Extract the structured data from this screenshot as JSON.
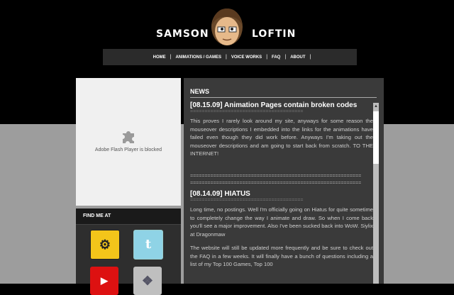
{
  "header": {
    "logo_left": "SAMSON",
    "logo_right": "LOFTIN"
  },
  "nav": {
    "items": [
      "HOME",
      "ANIMATIONS / GAMES",
      "VOICE WORKS",
      "FAQ",
      "ABOUT"
    ],
    "separator": "|"
  },
  "flash": {
    "message": "Adobe Flash Player is blocked"
  },
  "find_me": {
    "heading": "FIND ME AT",
    "links": [
      "game-icon",
      "twitter-icon",
      "youtube-icon",
      "deviantart-icon"
    ]
  },
  "news": {
    "heading": "NEWS",
    "posts": [
      {
        "title": "[08.15.09] Animation Pages contain broken codes",
        "rule": "=======================================",
        "body": "This proves I rarely look around my site, anyways for some reason the mouseover descriptions I embedded into the links for the animations have failed even though they did work before. Anyways I'm taking out the mouseover descriptions and am going to start back from scratch. TO THE INTERNET!"
      },
      {
        "title": "[08.14.09] HIATUS",
        "rule": "=======================================",
        "body": "Long time, no postings. Well I'm officially going on Hiatus for quite sometime to completely change the way I animate and draw. So when I come back you'll see a major improvement. Also I've been sucked back into WoW. Siylix at Dragonmaw",
        "body2": "The website will still be updated more frequently and be sure to check out the FAQ in a few weeks. It will finally have a bunch of questions including a list of my Top 100 Games, Top 100"
      }
    ],
    "divider": "==========================================================="
  },
  "colors": {
    "background": "#000000",
    "lower_background": "#9d9d9d",
    "panel": "#3a3a3a"
  }
}
